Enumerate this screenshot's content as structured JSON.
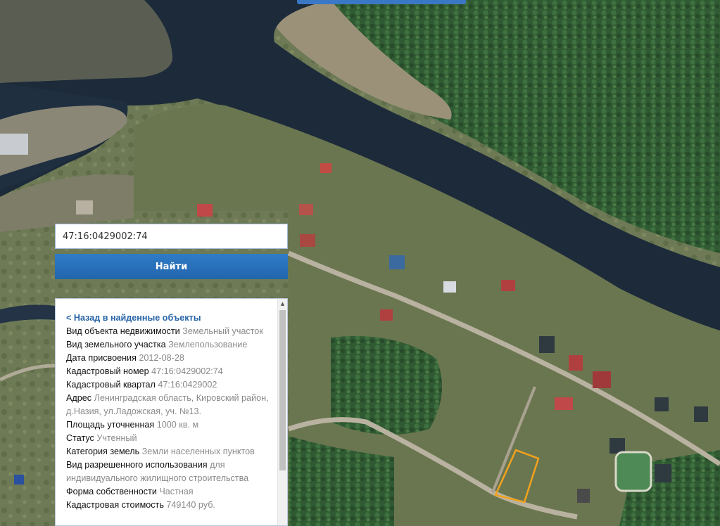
{
  "search": {
    "value": "47:16:0429002:74"
  },
  "find_button": {
    "label": "Найти"
  },
  "info_panel": {
    "back_link": "< Назад в найденные объекты",
    "fields": [
      {
        "label": "Вид объекта недвижимости",
        "value": "Земельный участок"
      },
      {
        "label": "Вид земельного участка",
        "value": "Землепользование"
      },
      {
        "label": "Дата присвоения",
        "value": "2012-08-28"
      },
      {
        "label": "Кадастровый номер",
        "value": "47:16:0429002:74"
      },
      {
        "label": "Кадастровый квартал",
        "value": "47:16:0429002"
      },
      {
        "label": "Адрес",
        "value": "Ленинградская область, Кировский район, д.Назия, ул.Ладожская, уч. №13."
      },
      {
        "label": "Площадь уточненная",
        "value": "1000 кв. м"
      },
      {
        "label": "Статус",
        "value": "Учтенный"
      },
      {
        "label": "Категория земель",
        "value": "Земли населенных пунктов"
      },
      {
        "label": "Вид разрешенного использования",
        "value": "для индивидуального жилищного строительства"
      },
      {
        "label": "Форма собственности",
        "value": "Частная"
      },
      {
        "label": "Кадастровая стоимость",
        "value": "749140 руб."
      }
    ]
  },
  "colors": {
    "accent": "#2a6fbb",
    "parcel_outline": "#f2a21e",
    "water": "#1c2a3a"
  }
}
